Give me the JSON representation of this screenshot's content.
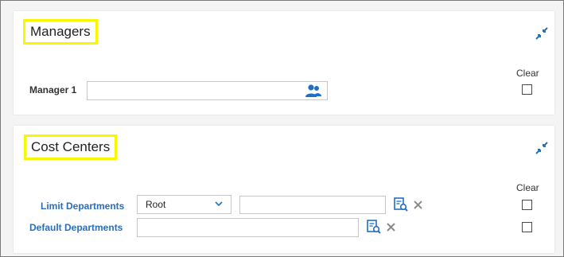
{
  "managers": {
    "title": "Managers",
    "clear_label": "Clear",
    "manager1_label": "Manager 1",
    "manager1_value": ""
  },
  "cost_centers": {
    "title": "Cost Centers",
    "clear_label": "Clear",
    "limit_departments_label": "Limit Departments",
    "limit_departments_select": "Root",
    "limit_departments_value": "",
    "default_departments_label": "Default Departments",
    "default_departments_value": ""
  },
  "icons": {
    "pin": "collapse-arrows-icon",
    "people": "people-lookup-icon",
    "lookup": "document-search-icon",
    "remove": "close-icon",
    "chevron": "chevron-down-icon"
  },
  "colors": {
    "highlight": "#f7f700",
    "accent_blue": "#2a6ebb"
  }
}
